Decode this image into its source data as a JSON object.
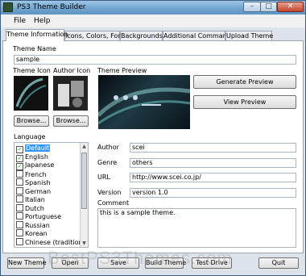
{
  "window": {
    "title": "PS3 Theme Builder",
    "minimize": "–",
    "maximize": "□",
    "close": "✕"
  },
  "menu": {
    "file": "File",
    "help": "Help"
  },
  "tabs": [
    {
      "label": "Theme Information",
      "active": true
    },
    {
      "label": "Icons, Colors, Font",
      "active": false
    },
    {
      "label": "Backgrounds",
      "active": false
    },
    {
      "label": "Additional Commands",
      "active": false
    },
    {
      "label": "Upload Theme",
      "active": false
    }
  ],
  "theme_info": {
    "theme_name_label": "Theme Name",
    "theme_name_value": "sample",
    "theme_icon_label": "Theme Icon",
    "author_icon_label": "Author Icon",
    "theme_preview_label": "Theme Preview",
    "browse_label": "Browse...",
    "generate_preview_label": "Generate Preview",
    "view_preview_label": "View Preview",
    "language_label": "Language",
    "languages": [
      {
        "name": "Default",
        "checked": true,
        "selected": true
      },
      {
        "name": "English",
        "checked": true,
        "selected": false
      },
      {
        "name": "Japanese",
        "checked": true,
        "selected": false
      },
      {
        "name": "French",
        "checked": false,
        "selected": false
      },
      {
        "name": "Spanish",
        "checked": false,
        "selected": false
      },
      {
        "name": "German",
        "checked": false,
        "selected": false
      },
      {
        "name": "Italian",
        "checked": false,
        "selected": false
      },
      {
        "name": "Dutch",
        "checked": false,
        "selected": false
      },
      {
        "name": "Portuguese",
        "checked": false,
        "selected": false
      },
      {
        "name": "Russian",
        "checked": false,
        "selected": false
      },
      {
        "name": "Korean",
        "checked": false,
        "selected": false
      },
      {
        "name": "Chinese (traditional)",
        "checked": false,
        "selected": false
      }
    ],
    "author_label": "Author",
    "author_value": "scei",
    "genre_label": "Genre",
    "genre_value": "others",
    "url_label": "URL",
    "url_value": "http://www.scei.co.jp/",
    "version_label": "Version",
    "version_value": "version 1.0",
    "comment_label": "Comment",
    "comment_value": "this is a sample theme."
  },
  "bottom_buttons": {
    "new_theme": "New Theme",
    "open": "Open",
    "save": "Save",
    "build_theme": "Build Theme",
    "test_drive": "Test Drive",
    "quit": "Quit"
  },
  "watermark": "BestPS3Themes.com"
}
